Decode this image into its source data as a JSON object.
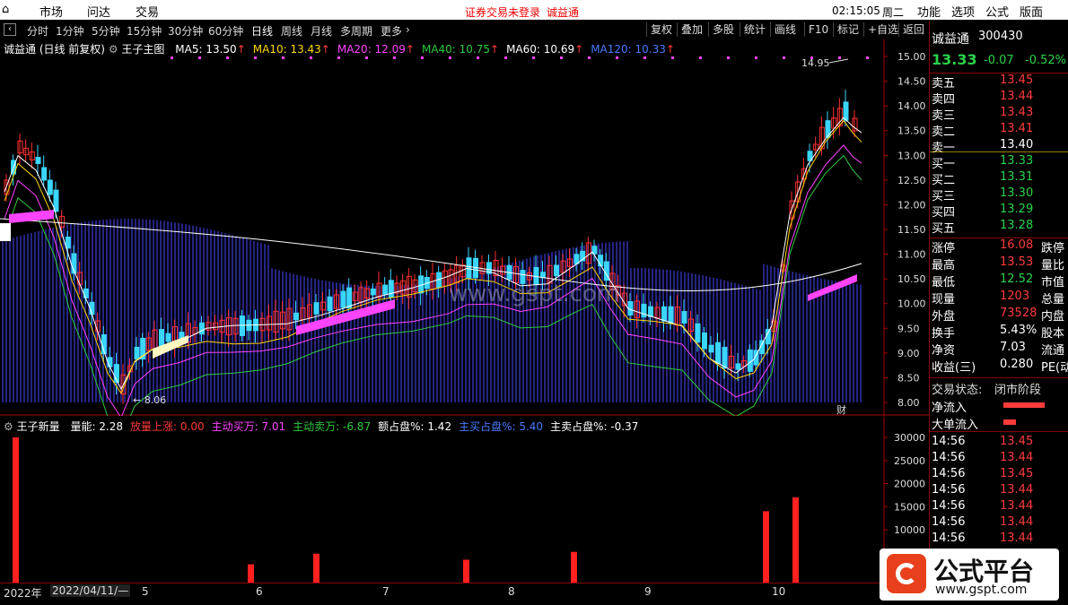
{
  "menu": {
    "items": [
      "市场",
      "问达",
      "交易"
    ],
    "warning": "证券交易未登录",
    "stock_link": "诚益通",
    "time": "02:15:05",
    "weekday": "周二",
    "right_items": [
      "功能",
      "选项",
      "公式",
      "版面"
    ]
  },
  "tabs": {
    "periods": [
      "分时",
      "1分钟",
      "5分钟",
      "15分钟",
      "30分钟",
      "60分钟",
      "日线",
      "周线",
      "月线",
      "多周期",
      "更多"
    ],
    "active": "日线",
    "tools": [
      "复权",
      "叠加",
      "多股",
      "统计",
      "画线",
      "F10",
      "标记",
      "+自选",
      "返回"
    ]
  },
  "main": {
    "title": "诚益通 (日线 前复权)",
    "indicator": "王子主图",
    "ma": [
      {
        "label": "MA5: 13.50",
        "color": "#ffffff"
      },
      {
        "label": "MA10: 13.43",
        "color": "#ffd700"
      },
      {
        "label": "MA20: 12.09",
        "color": "#ff44ff"
      },
      {
        "label": "MA40: 10.75",
        "color": "#2ecc40"
      },
      {
        "label": "MA60: 10.69",
        "color": "#ffffff"
      },
      {
        "label": "MA120: 10.33",
        "color": "#4a7bff"
      }
    ],
    "y_ticks": [
      "15.00",
      "14.50",
      "14.00",
      "13.50",
      "13.00",
      "12.50",
      "12.00",
      "11.50",
      "11.00",
      "10.50",
      "10.00",
      "9.50",
      "9.00",
      "8.50",
      "8.00"
    ],
    "high_label": "14.95",
    "low_label": "8.06",
    "watermark": "www.gspt.com",
    "bottom_mark": "财"
  },
  "sub": {
    "indicator": "王子新量",
    "values": [
      {
        "label": "量能: 2.28",
        "color": "#ffffff"
      },
      {
        "label": "放量上涨: 0.00",
        "color": "#ff3b3b"
      },
      {
        "label": "主动买万: 7.01",
        "color": "#ff44ff"
      },
      {
        "label": "主动卖万: -6.87",
        "color": "#2ecc40"
      },
      {
        "label": "额占盘%: 1.42",
        "color": "#ffffff"
      },
      {
        "label": "主买占盘%: 5.40",
        "color": "#4a7bff"
      },
      {
        "label": "主卖占盘%: -0.37",
        "color": "#ffffff"
      }
    ],
    "y_ticks": [
      "30000",
      "25000",
      "20000",
      "15000",
      "10000"
    ],
    "bars": [
      30000,
      2500,
      4800,
      3500,
      5200,
      14000,
      17000
    ]
  },
  "datebar": {
    "year": "2022年",
    "date": "2022/04/11/—",
    "months": [
      "5",
      "6",
      "7",
      "8",
      "9",
      "10"
    ]
  },
  "quote": {
    "name": "诚益通",
    "code": "300430",
    "price": "13.33",
    "change": "-0.07",
    "pct": "-0.52%",
    "sells": [
      {
        "label": "卖五",
        "price": "13.45"
      },
      {
        "label": "卖四",
        "price": "13.44"
      },
      {
        "label": "卖三",
        "price": "13.43"
      },
      {
        "label": "卖二",
        "price": "13.41"
      },
      {
        "label": "卖一",
        "price": "13.40"
      }
    ],
    "buys": [
      {
        "label": "买一",
        "price": "13.33"
      },
      {
        "label": "买二",
        "price": "13.31"
      },
      {
        "label": "买三",
        "price": "13.30"
      },
      {
        "label": "买四",
        "price": "13.29"
      },
      {
        "label": "买五",
        "price": "13.28"
      }
    ],
    "stats": [
      {
        "label": "涨停",
        "value": "16.08",
        "extra": "跌停"
      },
      {
        "label": "最高",
        "value": "13.53",
        "extra": "量比"
      },
      {
        "label": "最低",
        "value": "12.52",
        "extra": "市值"
      },
      {
        "label": "现量",
        "value": "1203",
        "extra": "总量"
      },
      {
        "label": "外盘",
        "value": "73528",
        "extra": "内盘"
      },
      {
        "label": "换手",
        "value": "5.43%",
        "extra": "股本"
      },
      {
        "label": "净资",
        "value": "7.03",
        "extra": "流通"
      },
      {
        "label": "收益(三)",
        "value": "0.280",
        "extra": "PE(动"
      }
    ],
    "status_label": "交易状态:",
    "status_value": "闭市阶段",
    "flow": [
      {
        "label": "净流入"
      },
      {
        "label": "大单流入"
      }
    ],
    "ticks": [
      {
        "time": "14:56",
        "price": "13.45"
      },
      {
        "time": "14:56",
        "price": "13.44"
      },
      {
        "time": "14:56",
        "price": "13.45"
      },
      {
        "time": "14:56",
        "price": "13.44"
      },
      {
        "time": "14:56",
        "price": "13.44"
      },
      {
        "time": "14:56",
        "price": "13.44"
      },
      {
        "time": "14:56",
        "price": "13.44"
      }
    ]
  },
  "logo": {
    "text": "公式平台",
    "url": "www.gspt.com"
  }
}
